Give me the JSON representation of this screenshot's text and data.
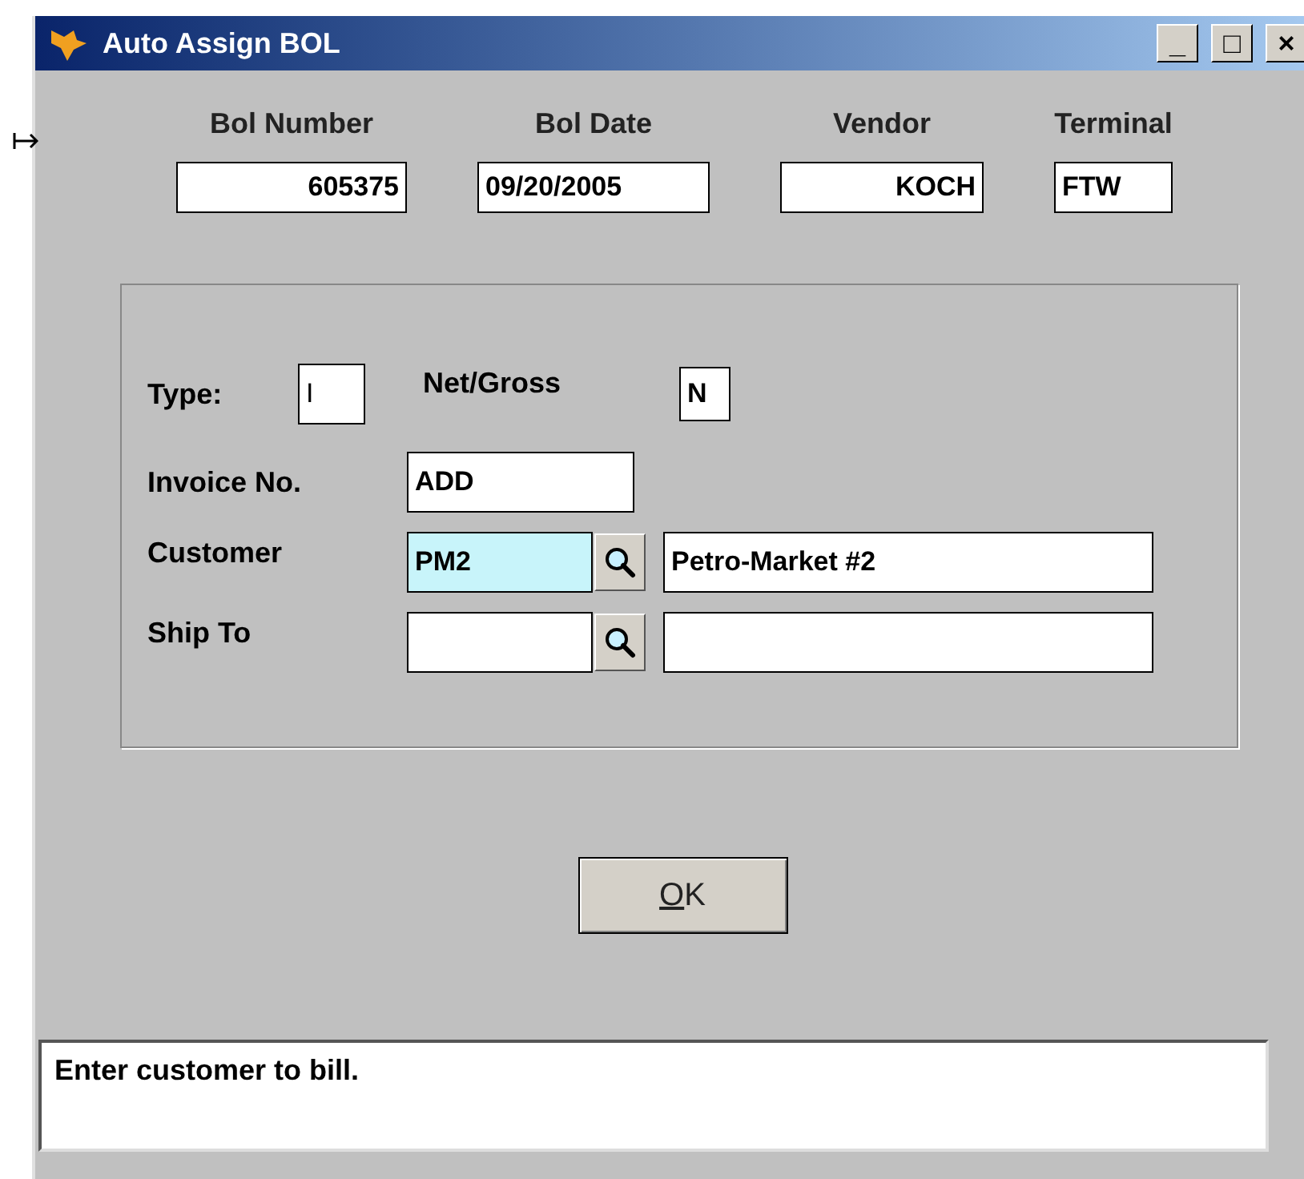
{
  "window": {
    "title": "Auto Assign BOL",
    "controls": [
      "_",
      "□",
      "×"
    ]
  },
  "header_fields": [
    {
      "label": "Bol Number",
      "value": "605375"
    },
    {
      "label": "Bol Date",
      "value": "09/20/2005"
    },
    {
      "label": "Vendor",
      "value": "KOCH"
    },
    {
      "label": "Terminal",
      "value": "FTW"
    }
  ],
  "type": {
    "label": "Type:",
    "value": "I"
  },
  "net_gross": {
    "label": "Net/Gross",
    "value": "N"
  },
  "invoice": {
    "label": "Invoice No.",
    "value": "ADD"
  },
  "lookups": [
    {
      "label": "Customer",
      "code": "PM2",
      "name": "Petro-Market #2",
      "focused": true
    },
    {
      "label": "Ship To",
      "focused": false
    }
  ],
  "ok_button": {
    "label": "OK"
  },
  "status_bar": {
    "message": "Enter customer to bill."
  }
}
